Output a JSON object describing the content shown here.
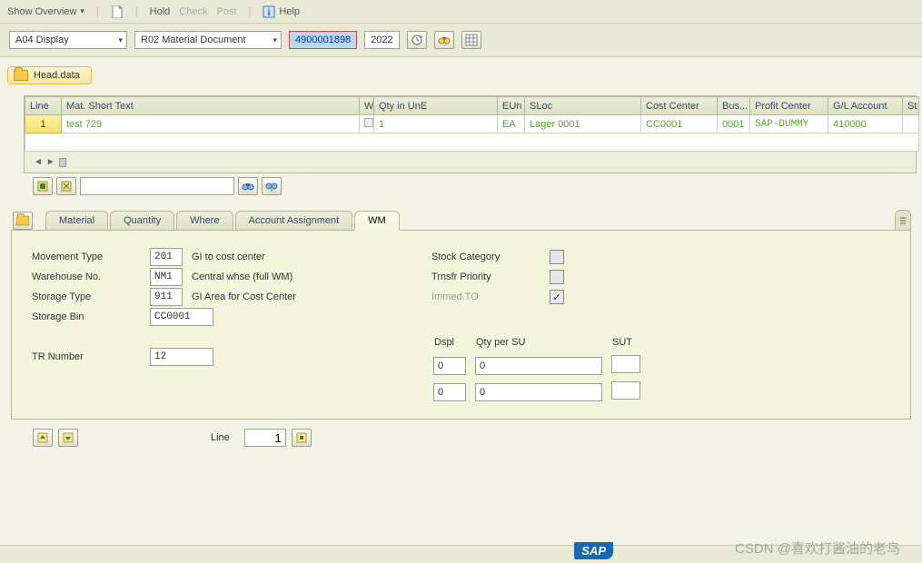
{
  "toolbar": {
    "show_overview": "Show Overview",
    "hold": "Hold",
    "check": "Check",
    "post": "Post",
    "help": "Help"
  },
  "criteria": {
    "activity": "A04 Display",
    "ref_doc": "R02 Material Document",
    "doc_no": "4900001898",
    "year": "2022"
  },
  "head_data": "Head.data",
  "grid": {
    "headers": {
      "line": "Line",
      "mat": "Mat. Short Text",
      "w": "W",
      "qty": "Qty in UnE",
      "eun": "EUn",
      "sloc": "SLoc",
      "cost": "Cost Center",
      "bus": "Bus...",
      "profit": "Profit Center",
      "gl": "G/L Account",
      "st": "St"
    },
    "row": {
      "line": "1",
      "mat": "test 729",
      "qty": "1",
      "eun": "EA",
      "sloc": "Lager 0001",
      "cost": "CC0001",
      "bus": "0001",
      "profit": "SAP-DUMMY",
      "gl": "410000"
    }
  },
  "tabs": {
    "material": "Material",
    "quantity": "Quantity",
    "where": "Where",
    "account": "Account Assignment",
    "wm": "WM"
  },
  "wm": {
    "movement_type_l": "Movement Type",
    "movement_type_v": "201",
    "movement_type_d": "GI to cost center",
    "warehouse_l": "Warehouse No.",
    "warehouse_v": "NM1",
    "warehouse_d": "Central whse (full WM)",
    "storage_type_l": "Storage Type",
    "storage_type_v": "911",
    "storage_type_d": "GI Area for Cost Center",
    "storage_bin_l": "Storage Bin",
    "storage_bin_v": "CC0001",
    "tr_number_l": "TR Number",
    "tr_number_v": "12",
    "stock_cat_l": "Stock Category",
    "trnsfr_pri_l": "Trnsfr Priority",
    "immed_to_l": "Immed.TO",
    "dspl_h": "Dspl",
    "qty_su_h": "Qty per SU",
    "sut_h": "SUT",
    "dspl1": "0",
    "qty1": "0",
    "dspl2": "0",
    "qty2": "0"
  },
  "footer": {
    "line_label": "Line",
    "line_value": "1"
  },
  "branding": {
    "sap": "SAP",
    "watermark": "CSDN @喜欢打酱油的老鸟"
  }
}
